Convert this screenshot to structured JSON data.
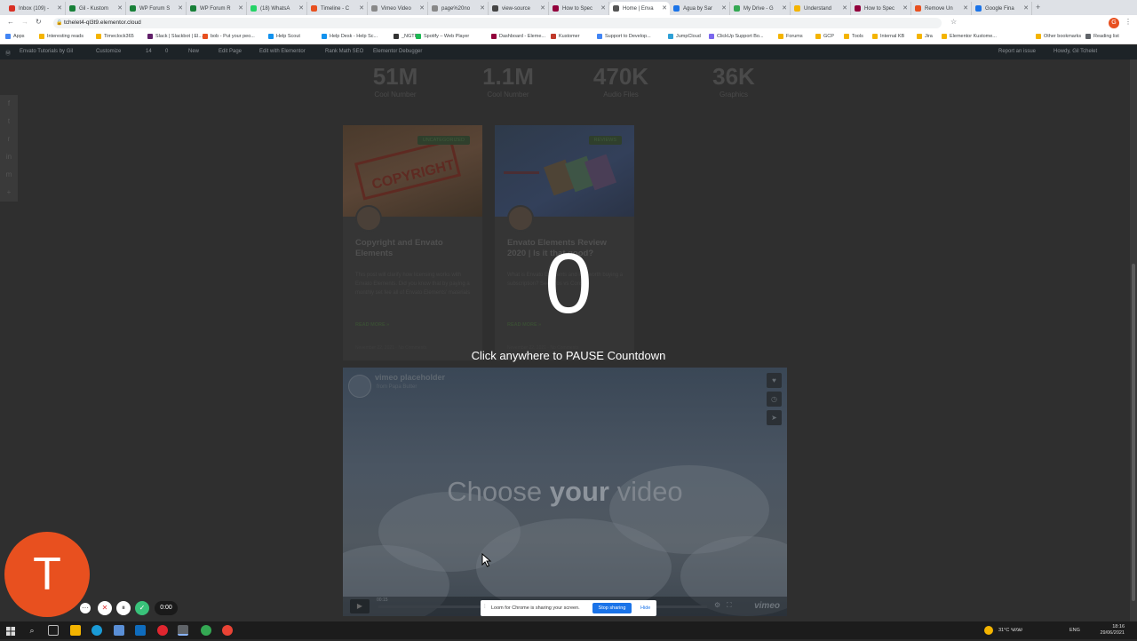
{
  "tabs": [
    {
      "label": "Inbox (109) -",
      "color": "#d93025"
    },
    {
      "label": "Gil - Kustom",
      "color": "#188038"
    },
    {
      "label": "WP Forum S",
      "color": "#188038"
    },
    {
      "label": "WP Forum R",
      "color": "#188038"
    },
    {
      "label": "(18) WhatsA",
      "color": "#25d366"
    },
    {
      "label": "Timeline - C",
      "color": "#e8501f"
    },
    {
      "label": "Vimeo Video",
      "color": "#888888"
    },
    {
      "label": "page%20no",
      "color": "#888888"
    },
    {
      "label": "view-source",
      "color": "#444444"
    },
    {
      "label": "How to Spec",
      "color": "#92003b"
    },
    {
      "label": "Home | Enva",
      "color": "#555555",
      "active": true
    },
    {
      "label": "Agua by Sar",
      "color": "#1a73e8"
    },
    {
      "label": "My Drive - G",
      "color": "#34a853"
    },
    {
      "label": "Understand",
      "color": "#f4b400"
    },
    {
      "label": "How to Spec",
      "color": "#92003b"
    },
    {
      "label": "Remove Un",
      "color": "#e8501f"
    },
    {
      "label": "Google Fina",
      "color": "#1a73e8"
    }
  ],
  "address": {
    "url": "tchelet4-ql3t9.elementor.cloud"
  },
  "bookmarks": [
    {
      "label": "Apps",
      "color": "#4285f4"
    },
    {
      "label": "Interesting reads",
      "color": "#f4b400"
    },
    {
      "label": "Timeclock365",
      "color": "#f4b400"
    },
    {
      "label": "Slack | Slackbot | El...",
      "color": "#611f69"
    },
    {
      "label": "bob - Put your peo...",
      "color": "#e8501f"
    },
    {
      "label": "Help Scout",
      "color": "#1292ee"
    },
    {
      "label": "Help Desk - Help Sc...",
      "color": "#1292ee"
    },
    {
      "label": "_NGTR",
      "color": "#333333"
    },
    {
      "label": "Spotify – Web Player",
      "color": "#1db954"
    },
    {
      "label": "Dashboard - Eleme...",
      "color": "#92003b"
    },
    {
      "label": "Kustomer",
      "color": "#c0392b"
    },
    {
      "label": "Support to Develop...",
      "color": "#4285f4"
    },
    {
      "label": "JumpCloud",
      "color": "#2ea0d6"
    },
    {
      "label": "ClickUp Support Bo...",
      "color": "#7b68ee"
    },
    {
      "label": "Forums",
      "color": "#f4b400"
    },
    {
      "label": "GCP",
      "color": "#f4b400"
    },
    {
      "label": "Tools",
      "color": "#f4b400"
    },
    {
      "label": "Internal KB",
      "color": "#f4b400"
    },
    {
      "label": "Jira",
      "color": "#f4b400"
    },
    {
      "label": "Elementor Kustome...",
      "color": "#f4b400"
    },
    {
      "label": "Other bookmarks",
      "color": "#f4b400"
    },
    {
      "label": "Reading list",
      "color": "#5f6368"
    }
  ],
  "wpbar": {
    "items": [
      "Envato Tutorials by Gil",
      "Customize",
      "14",
      "0",
      "New",
      "Edit Page",
      "Edit with Elementor",
      "Rank Math SEO",
      "Elementor Debugger"
    ],
    "right": [
      "Report an issue",
      "Howdy, Gil Tchelet"
    ]
  },
  "stats": [
    {
      "num": "51M",
      "label": "Cool Number"
    },
    {
      "num": "1.1M",
      "label": "Cool Number"
    },
    {
      "num": "470K",
      "label": "Audio Files"
    },
    {
      "num": "36K",
      "label": "Graphics"
    }
  ],
  "cards": [
    {
      "badge": "UNCATEGORIZED",
      "title": "Copyright and Envato Elements",
      "excerpt": "This post will clarify how licensing works with Envato Elements. Did you know that by paying a monthly set fee all of Envato Elements' materials",
      "readmore": "READ MORE »",
      "meta": "November 22, 2021 · No Comments"
    },
    {
      "badge": "REVIEWS",
      "title": "Envato Elements Review 2020 | Is it that good?",
      "excerpt": "What is Envato Elements and is it worth buying a subscription? See Pros vs Cons",
      "readmore": "READ MORE »",
      "meta": "November 22, 2021 · No Comments"
    }
  ],
  "countdown": {
    "value": "0",
    "hint": "Click anywhere to PAUSE Countdown"
  },
  "video": {
    "title": "vimeo placeholder",
    "from": "from Papa Butter",
    "choose_a": "Choose ",
    "choose_b": "your",
    "choose_c": " video",
    "brand": "vimeo",
    "time": "00:15"
  },
  "recorder": {
    "initial": "T",
    "timer": "0:00",
    "avatar_color": "#e8501f"
  },
  "sharing": {
    "message": "Loom for Chrome is sharing your screen.",
    "stop": "Stop sharing",
    "hide": "Hide"
  },
  "tray": {
    "weather": "31°C",
    "weather_desc": "שמשי",
    "lang": "ENG",
    "time": "18:16",
    "date": "29/06/2021"
  }
}
